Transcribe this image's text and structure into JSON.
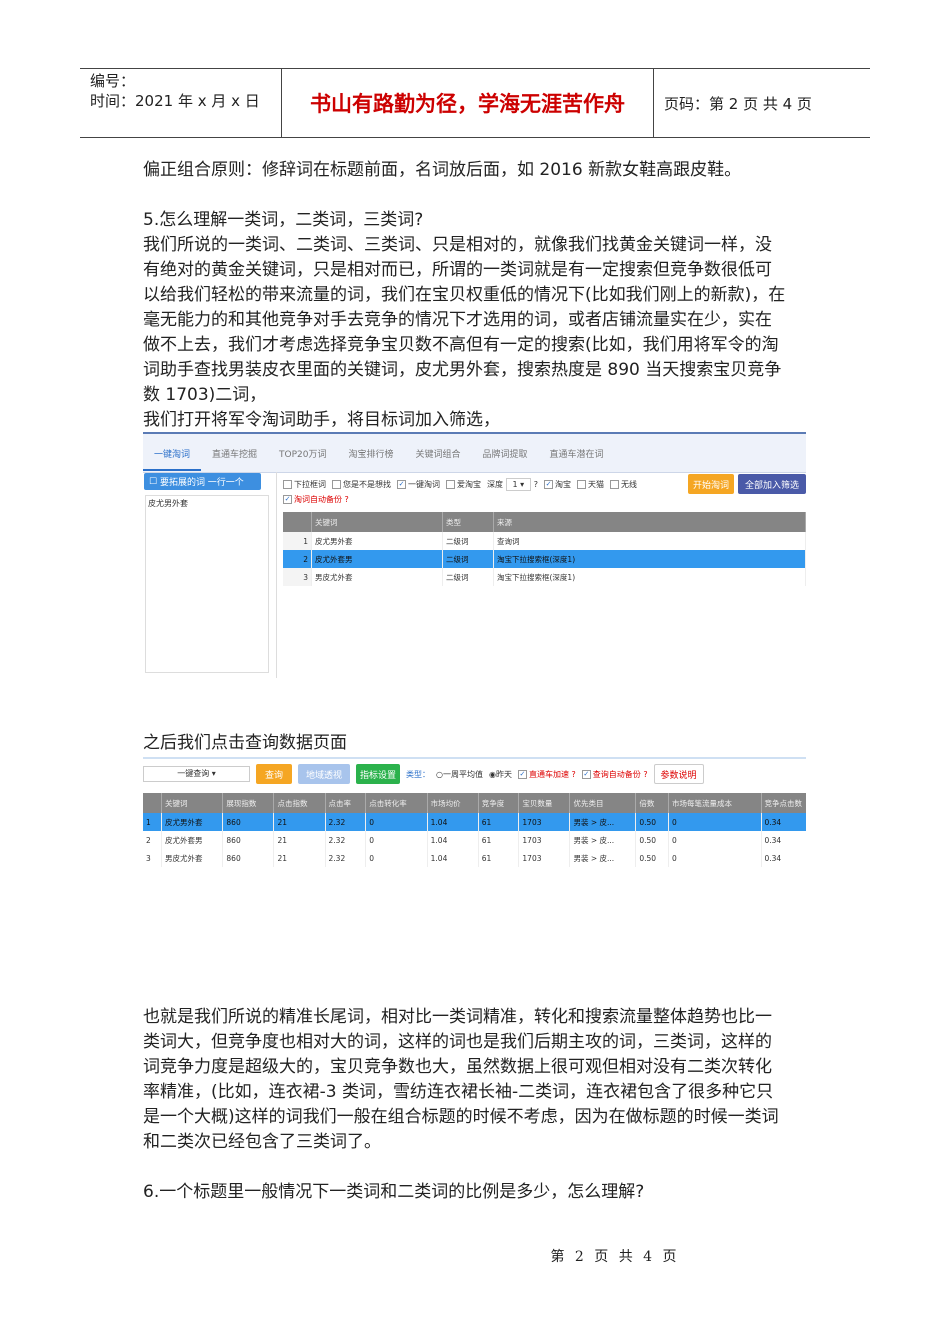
{
  "header": {
    "number_label": "编号：",
    "time_label": "时间：2021 年 x 月 x 日",
    "motto": "书山有路勤为径，学海无涯苦作舟",
    "page_label": "页码：第 2 页  共 4 页"
  },
  "para1": [
    "偏正组合原则：修辞词在标题前面，名词放后面，如 2016 新款女鞋高跟皮鞋。"
  ],
  "para2": [
    "5.怎么理解一类词，二类词，三类词?",
    "我们所说的一类词、二类词、三类词、只是相对的，就像我们找黄金关键词一样，没",
    "有绝对的黄金关键词，只是相对而已，所谓的一类词就是有一定搜索但竞争数很低可",
    "以给我们轻松的带来流量的词，我们在宝贝权重低的情况下(比如我们刚上的新款)，在",
    "毫无能力的和其他竞争对手去竞争的情况下才选用的词，或者店铺流量实在少，实在",
    "做不上去，我们才考虑选择竞争宝贝数不高但有一定的搜索(比如，我们用将军令的淘",
    "词助手查找男装皮衣里面的关键词，皮尤男外套，搜索热度是 890 当天搜索宝贝竞争",
    "数 1703)二词，",
    "我们打开将军令淘词助手，将目标词加入筛选，"
  ],
  "shot1": {
    "tabs": [
      "一键淘词",
      "直通车挖掘",
      "TOP20万词",
      "淘宝排行榜",
      "关键词组合",
      "品牌词提取",
      "直通车潜在词"
    ],
    "expand_button": "要拓展的词 一行一个",
    "input_value": "皮尤男外套",
    "options": [
      {
        "label": "下拉框词",
        "checked": false
      },
      {
        "label": "您是不是想找",
        "checked": false
      },
      {
        "label": "一键淘词",
        "checked": true
      },
      {
        "label": "爱淘宝",
        "checked": false
      }
    ],
    "depth_label": "深度",
    "depth_value": "1",
    "help": "?",
    "platforms": [
      {
        "label": "淘宝",
        "checked": true
      },
      {
        "label": "天猫",
        "checked": false
      },
      {
        "label": "无线",
        "checked": false
      }
    ],
    "start_button": "开始淘词",
    "add_all_button": "全部加入筛选",
    "backup_label": "淘词自动备份",
    "columns": [
      "关键词",
      "类型",
      "来源"
    ],
    "rows": [
      {
        "n": "1",
        "kw": "皮尤男外套",
        "type": "二级词",
        "src": "查询词"
      },
      {
        "n": "2",
        "kw": "皮尤外套男",
        "type": "二级词",
        "src": "淘宝下拉搜索框(深度1)"
      },
      {
        "n": "3",
        "kw": "男皮尤外套",
        "type": "二级词",
        "src": "淘宝下拉搜索框(深度1)"
      }
    ]
  },
  "para3": [
    "之后我们点击查询数据页面"
  ],
  "shot2": {
    "select_value": "一键查询",
    "query_button": "查询",
    "region_button": "地域透视",
    "metric_button": "指标设置",
    "type_label": "类型：",
    "radio_week": "一周平均值",
    "radio_yesterday": "昨天",
    "accel_label": "直通车加速",
    "backup_label": "查询自动备份",
    "help": "?",
    "param_button": "参数说明",
    "columns": [
      "关键词",
      "展现指数",
      "点击指数",
      "点击率",
      "点击转化率",
      "市场均价",
      "竞争度",
      "宝贝数量",
      "优先类目",
      "倍数",
      "市场每笔流量成本",
      "竞争点击数"
    ],
    "rows": [
      [
        "1",
        "皮尤男外套",
        "860",
        "21",
        "2.32",
        "0",
        "1.04",
        "61",
        "1703",
        "男装 > 皮...",
        "0.50",
        "0",
        "0.34"
      ],
      [
        "2",
        "皮尤外套男",
        "860",
        "21",
        "2.32",
        "0",
        "1.04",
        "61",
        "1703",
        "男装 > 皮...",
        "0.50",
        "0",
        "0.34"
      ],
      [
        "3",
        "男皮尤外套",
        "860",
        "21",
        "2.32",
        "0",
        "1.04",
        "61",
        "1703",
        "男装 > 皮...",
        "0.50",
        "0",
        "0.34"
      ]
    ]
  },
  "para4": [
    "也就是我们所说的精准长尾词，相对比一类词精准，转化和搜索流量整体趋势也比一",
    "类词大，但竞争度也相对大的词，这样的词也是我们后期主攻的词，三类词，这样的",
    "词竞争力度是超级大的，宝贝竞争数也大，虽然数据上很可观但相对没有二类次转化",
    "率精准，(比如，连衣裙-3 类词，雪纺连衣裙长袖-二类词，连衣裙包含了很多种它只",
    "是一个大概)这样的词我们一般在组合标题的时候不考虑，因为在做标题的时候一类词",
    "和二类次已经包含了三类词了。"
  ],
  "para5": [
    "6.一个标题里一般情况下一类词和二类词的比例是多少，怎么理解?"
  ],
  "footer": "第 2 页 共 4 页"
}
